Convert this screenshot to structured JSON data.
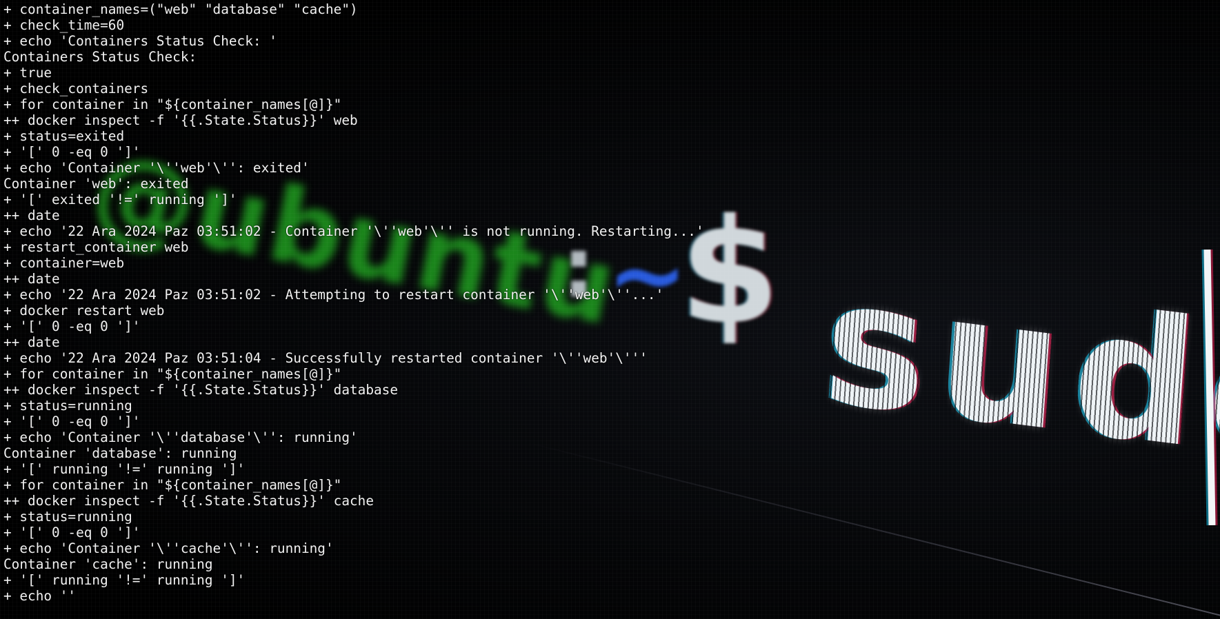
{
  "wallpaper": {
    "prompt_user": "@ubuntu",
    "prompt_colon": ":",
    "prompt_tilde": "~",
    "prompt_dollar": "$",
    "command": "sudo",
    "colors": {
      "user": "#1f9d1f",
      "tilde": "#2a5fe8",
      "text": "#eef3f6"
    }
  },
  "terminal": {
    "lines": [
      "+ container_names=(\"web\" \"database\" \"cache\")",
      "+ check_time=60",
      "+ echo 'Containers Status Check: '",
      "Containers Status Check:",
      "+ true",
      "+ check_containers",
      "+ for container in \"${container_names[@]}\"",
      "++ docker inspect -f '{{.State.Status}}' web",
      "+ status=exited",
      "+ '[' 0 -eq 0 ']'",
      "+ echo 'Container '\\''web'\\'': exited'",
      "Container 'web': exited",
      "+ '[' exited '!=' running ']'",
      "++ date",
      "+ echo '22 Ara 2024 Paz 03:51:02 - Container '\\''web'\\'' is not running. Restarting...'",
      "+ restart_container web",
      "+ container=web",
      "++ date",
      "+ echo '22 Ara 2024 Paz 03:51:02 - Attempting to restart container '\\''web'\\''...'",
      "+ docker restart web",
      "+ '[' 0 -eq 0 ']'",
      "++ date",
      "+ echo '22 Ara 2024 Paz 03:51:04 - Successfully restarted container '\\''web'\\'''",
      "+ for container in \"${container_names[@]}\"",
      "++ docker inspect -f '{{.State.Status}}' database",
      "+ status=running",
      "+ '[' 0 -eq 0 ']'",
      "+ echo 'Container '\\''database'\\'': running'",
      "Container 'database': running",
      "+ '[' running '!=' running ']'",
      "+ for container in \"${container_names[@]}\"",
      "++ docker inspect -f '{{.State.Status}}' cache",
      "+ status=running",
      "+ '[' 0 -eq 0 ']'",
      "+ echo 'Container '\\''cache'\\'': running'",
      "Container 'cache': running",
      "+ '[' running '!=' running ']'",
      "+ echo ''"
    ]
  }
}
